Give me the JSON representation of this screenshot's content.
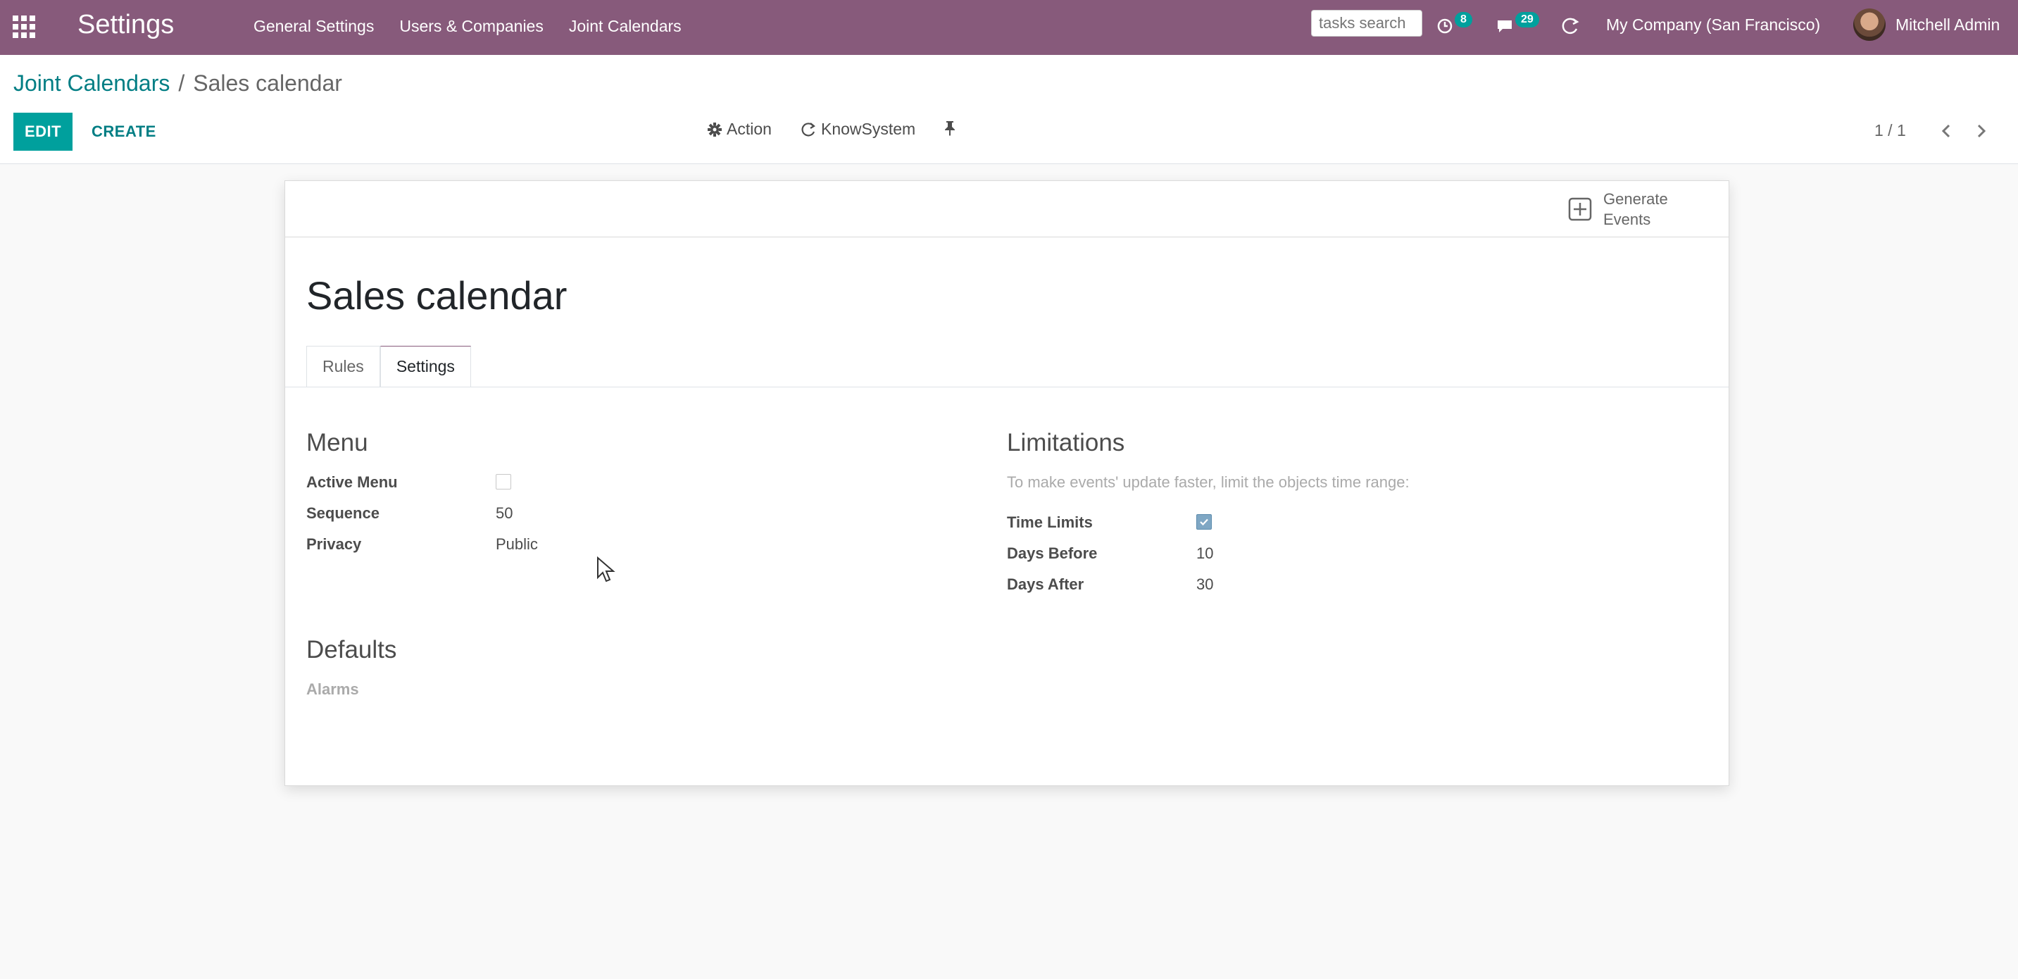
{
  "navbar": {
    "brand": "Settings",
    "menu": [
      "General Settings",
      "Users & Companies",
      "Joint Calendars"
    ],
    "search_placeholder": "tasks search",
    "activity_count": "8",
    "messages_count": "29",
    "company": "My Company (San Francisco)",
    "user": "Mitchell Admin",
    "bg_color": "#875a7b"
  },
  "control_panel": {
    "breadcrumb_parent": "Joint Calendars",
    "breadcrumb_separator": "/",
    "breadcrumb_current": "Sales calendar",
    "edit_label": "EDIT",
    "create_label": "CREATE",
    "action_label": "Action",
    "knowsystem_label": "KnowSystem",
    "pager": "1 / 1"
  },
  "form": {
    "button_box": {
      "generate_events": "Generate Events"
    },
    "title": "Sales calendar",
    "tabs": [
      {
        "label": "Rules",
        "active": false
      },
      {
        "label": "Settings",
        "active": true
      }
    ],
    "menu_group": {
      "title": "Menu",
      "active_menu_label": "Active Menu",
      "active_menu_checked": false,
      "sequence_label": "Sequence",
      "sequence_value": "50",
      "privacy_label": "Privacy",
      "privacy_value": "Public"
    },
    "limitations_group": {
      "title": "Limitations",
      "help_text": "To make events' update faster, limit the objects time range:",
      "time_limits_label": "Time Limits",
      "time_limits_checked": true,
      "days_before_label": "Days Before",
      "days_before_value": "10",
      "days_after_label": "Days After",
      "days_after_value": "30"
    },
    "defaults_group": {
      "title": "Defaults",
      "alarms_label": "Alarms"
    }
  },
  "colors": {
    "accent": "#00a09d",
    "link": "#017e84",
    "brand": "#875a7b"
  }
}
